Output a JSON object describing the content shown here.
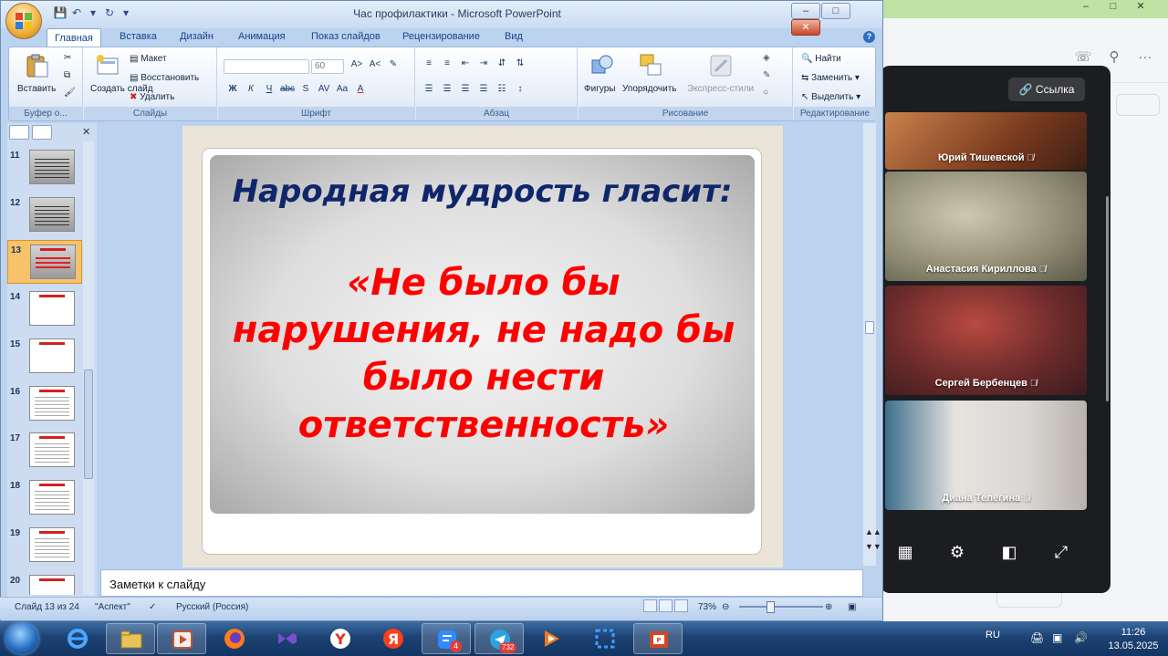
{
  "background_app": {
    "window_controls": [
      "–",
      "□",
      "✕"
    ],
    "toolbar_icons": [
      "phone-icon",
      "search-icon",
      "more-icon"
    ],
    "more_label": "···"
  },
  "call_panel": {
    "link_button": "Ссылка",
    "participants": [
      {
        "name": "Юрий Тишевской"
      },
      {
        "name": "Анастасия Кириллова"
      },
      {
        "name": "Сергей Бербенцев"
      },
      {
        "name": "Диана Телегина"
      }
    ],
    "controls": [
      "grid-icon",
      "settings-icon",
      "layout-icon",
      "fullscreen-icon"
    ]
  },
  "ppt": {
    "title": "Час профилактики - Microsoft PowerPoint",
    "tabs": [
      "Главная",
      "Вставка",
      "Дизайн",
      "Анимация",
      "Показ слайдов",
      "Рецензирование",
      "Вид"
    ],
    "ribbon": {
      "clipboard": {
        "paste": "Вставить",
        "label": "Буфер о..."
      },
      "slides": {
        "create": "Создать слайд",
        "layout": "Макет",
        "reset": "Восстановить",
        "delete": "Удалить",
        "label": "Слайды"
      },
      "font": {
        "font_name": "",
        "font_size": "60",
        "label": "Шрифт",
        "buttons": [
          "Ж",
          "К",
          "Ч",
          "abc",
          "S",
          "AV",
          "Aa",
          "A"
        ]
      },
      "paragraph": {
        "label": "Абзац"
      },
      "drawing": {
        "shapes": "Фигуры",
        "arrange": "Упорядочить",
        "quick_styles": "Экспресс-стили",
        "label": "Рисование"
      },
      "editing": {
        "find": "Найти",
        "replace": "Заменить",
        "select": "Выделить",
        "label": "Редактирование"
      }
    },
    "thumbnails": [
      "11",
      "12",
      "13",
      "14",
      "15",
      "16",
      "17",
      "18",
      "19",
      "20"
    ],
    "selected_thumbnail": "13",
    "slide": {
      "title": "Народная мудрость гласит:",
      "quote": "«Не было бы нарушения, не надо бы было нести ответственность»"
    },
    "notes_placeholder": "Заметки к слайду",
    "status": {
      "slide": "Слайд 13 из 24",
      "theme": "\"Аспект\"",
      "language": "Русский (Россия)",
      "zoom": "73%"
    }
  },
  "taskbar": {
    "apps": [
      "explorer",
      "internet-explorer",
      "file-manager",
      "media-player",
      "firefox",
      "visual-studio",
      "yandex-browser",
      "yandex",
      "messenger",
      "telegram",
      "media",
      "snipping-tool",
      "powerpoint"
    ],
    "badge_messenger": "4",
    "badge_telegram": "732",
    "language": "RU",
    "time": "11:26",
    "date": "13.05.2025"
  },
  "colors": {
    "slide_title": "#10266a",
    "slide_quote": "#ff0000",
    "selected_thumb": "#f7c26a"
  }
}
